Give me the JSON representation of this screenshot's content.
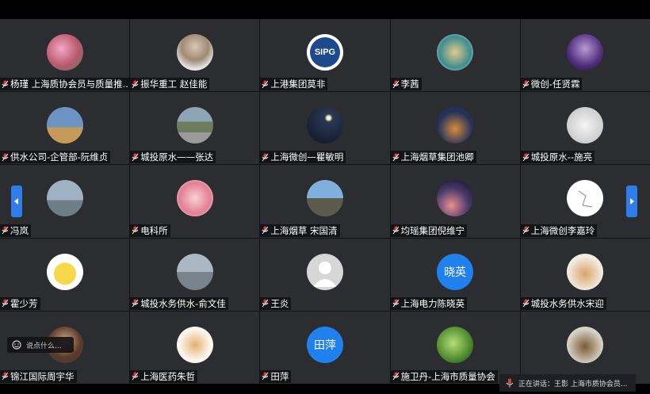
{
  "participants": [
    {
      "name": "杨瑾 上海质协会员与质量推...",
      "avatar": "flowers-photo"
    },
    {
      "name": "振华重工 赵佳能",
      "avatar": "man-photo"
    },
    {
      "name": "上港集团莫非",
      "avatar": "sipg-logo",
      "text": "SIPG"
    },
    {
      "name": "李茜",
      "avatar": "bird-illustration"
    },
    {
      "name": "微创-任贤霖",
      "avatar": "lightning-photo"
    },
    {
      "name": "供水公司-企管部-阮维贞",
      "avatar": "desert-jump-photo"
    },
    {
      "name": "城投原水——张达",
      "avatar": "road-photo"
    },
    {
      "name": "上海微创—瞿敏明",
      "avatar": "moon-photo"
    },
    {
      "name": "上海烟草集团池卿",
      "avatar": "city-night-photo"
    },
    {
      "name": "城投原水--施亮",
      "avatar": "sketch-drawing"
    },
    {
      "name": "冯岚",
      "avatar": "beach-photo"
    },
    {
      "name": "电科所",
      "avatar": "pink-character"
    },
    {
      "name": "上海烟草 宋国清",
      "avatar": "man-sunglasses-photo"
    },
    {
      "name": "均瑶集团倪维宁",
      "avatar": "galaxy-photo"
    },
    {
      "name": "上海微创李嘉玲",
      "avatar": "line-art-logo"
    },
    {
      "name": "霍少芳",
      "avatar": "pikachu-picture"
    },
    {
      "name": "城投水务供水-俞文佳",
      "avatar": "building-photo"
    },
    {
      "name": "王炎",
      "avatar": "default-user-icon"
    },
    {
      "name": "上海电力陈晓英",
      "avatar": "initials-blue",
      "text": "晓英"
    },
    {
      "name": "城投水务供水宋迎",
      "avatar": "cats-painting"
    },
    {
      "name": "锦江国际周宇华",
      "avatar": "man-standing-photo"
    },
    {
      "name": "上海医药朱哲",
      "avatar": "tiger-drawing"
    },
    {
      "name": "田萍",
      "avatar": "initials-blue",
      "text": "田萍"
    },
    {
      "name": "施卫丹-上海市质量协会",
      "avatar": "green-leaf-photo"
    },
    {
      "name": "",
      "avatar": "horse-sculpture-photo"
    }
  ],
  "chat_placeholder": "说点什么...",
  "speaking_text": "正在讲话：王影 上海市质协会员...",
  "colors": {
    "accent": "#2f7de8",
    "tile": "#2b2d31",
    "mic": "#e33a3a"
  }
}
